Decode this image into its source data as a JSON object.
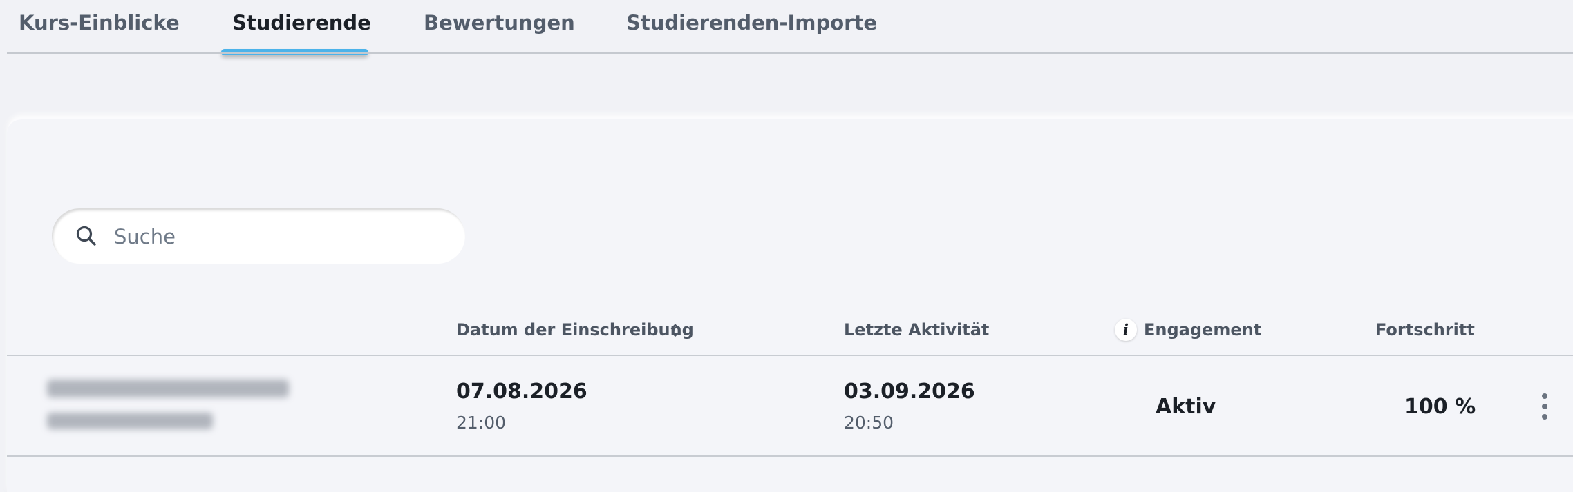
{
  "tabs": [
    {
      "label": "Kurs-Einblicke",
      "active": false
    },
    {
      "label": "Studierende",
      "active": true
    },
    {
      "label": "Bewertungen",
      "active": false
    },
    {
      "label": "Studierenden-Importe",
      "active": false
    }
  ],
  "colors": {
    "accent": "#4cb3ea",
    "text": "#1b2027",
    "muted": "#535d6b",
    "background": "#f1f2f6"
  },
  "search": {
    "placeholder": "Suche",
    "value": "",
    "icon": "search-icon"
  },
  "table": {
    "headers": {
      "enrollment_date": "Datum der Einschreibung",
      "last_activity": "Letzte Aktivität",
      "engagement": "Engagement",
      "progress": "Fortschritt"
    },
    "rows": [
      {
        "student_name": "",
        "enrollment_date": "07.08.2026",
        "enrollment_time": "21:00",
        "last_activity_date": "03.09.2026",
        "last_activity_time": "20:50",
        "engagement": "Aktiv",
        "progress": "100 %"
      }
    ]
  },
  "icons": {
    "sort": "sort-updown-icon",
    "info": "info-icon",
    "row_menu": "more-vertical-icon"
  }
}
